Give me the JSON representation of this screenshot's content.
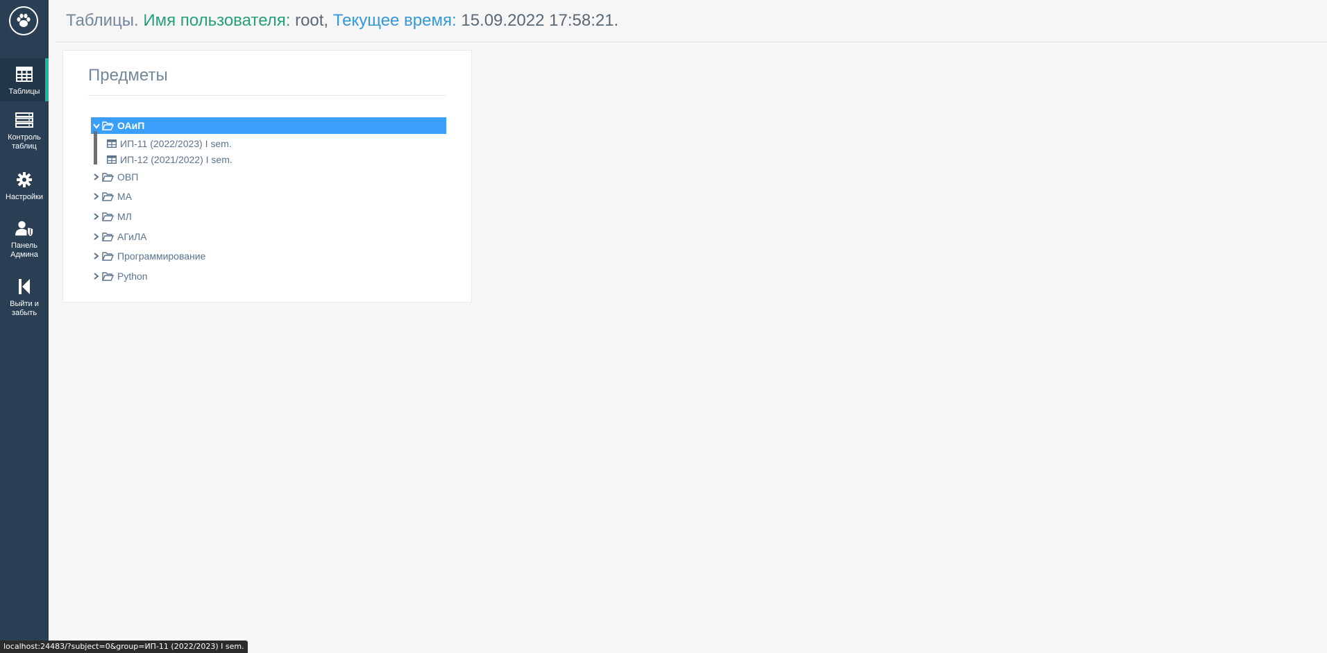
{
  "header": {
    "prefix": "Таблицы.",
    "user_label": "Имя пользователя:",
    "user_value": "root,",
    "time_label": "Текущее время:",
    "time_value": "15.09.2022 17:58:21."
  },
  "sidebar": {
    "items": [
      {
        "label": "Таблицы",
        "icon": "table-icon",
        "active": true
      },
      {
        "label": "Контроль таблиц",
        "icon": "server-icon",
        "active": false
      },
      {
        "label": "Настройки",
        "icon": "gear-icon",
        "active": false
      },
      {
        "label": "Панель Админа",
        "icon": "user-shield-icon",
        "active": false
      },
      {
        "label": "Выйти и забыть",
        "icon": "step-backward-icon",
        "active": false
      }
    ]
  },
  "panel": {
    "title": "Предметы",
    "tree": [
      {
        "label": "ОАиП",
        "expanded": true,
        "selected": true,
        "children": [
          "ИП-11 (2022/2023) I sem.",
          "ИП-12 (2021/2022) I sem."
        ]
      },
      {
        "label": "ОВП"
      },
      {
        "label": "МА"
      },
      {
        "label": "МЛ"
      },
      {
        "label": "АГиЛА"
      },
      {
        "label": "Программирование"
      },
      {
        "label": "Python"
      }
    ]
  },
  "statusbar": {
    "url": "localhost:24483/?subject=0&group=ИП-11 (2022/2023) I sem."
  },
  "colors": {
    "sidebar": "#2a3f54",
    "accent": "#1abb9c",
    "selected": "#3a9ffb",
    "green_text": "#26a07a",
    "blue_text": "#3498db"
  }
}
